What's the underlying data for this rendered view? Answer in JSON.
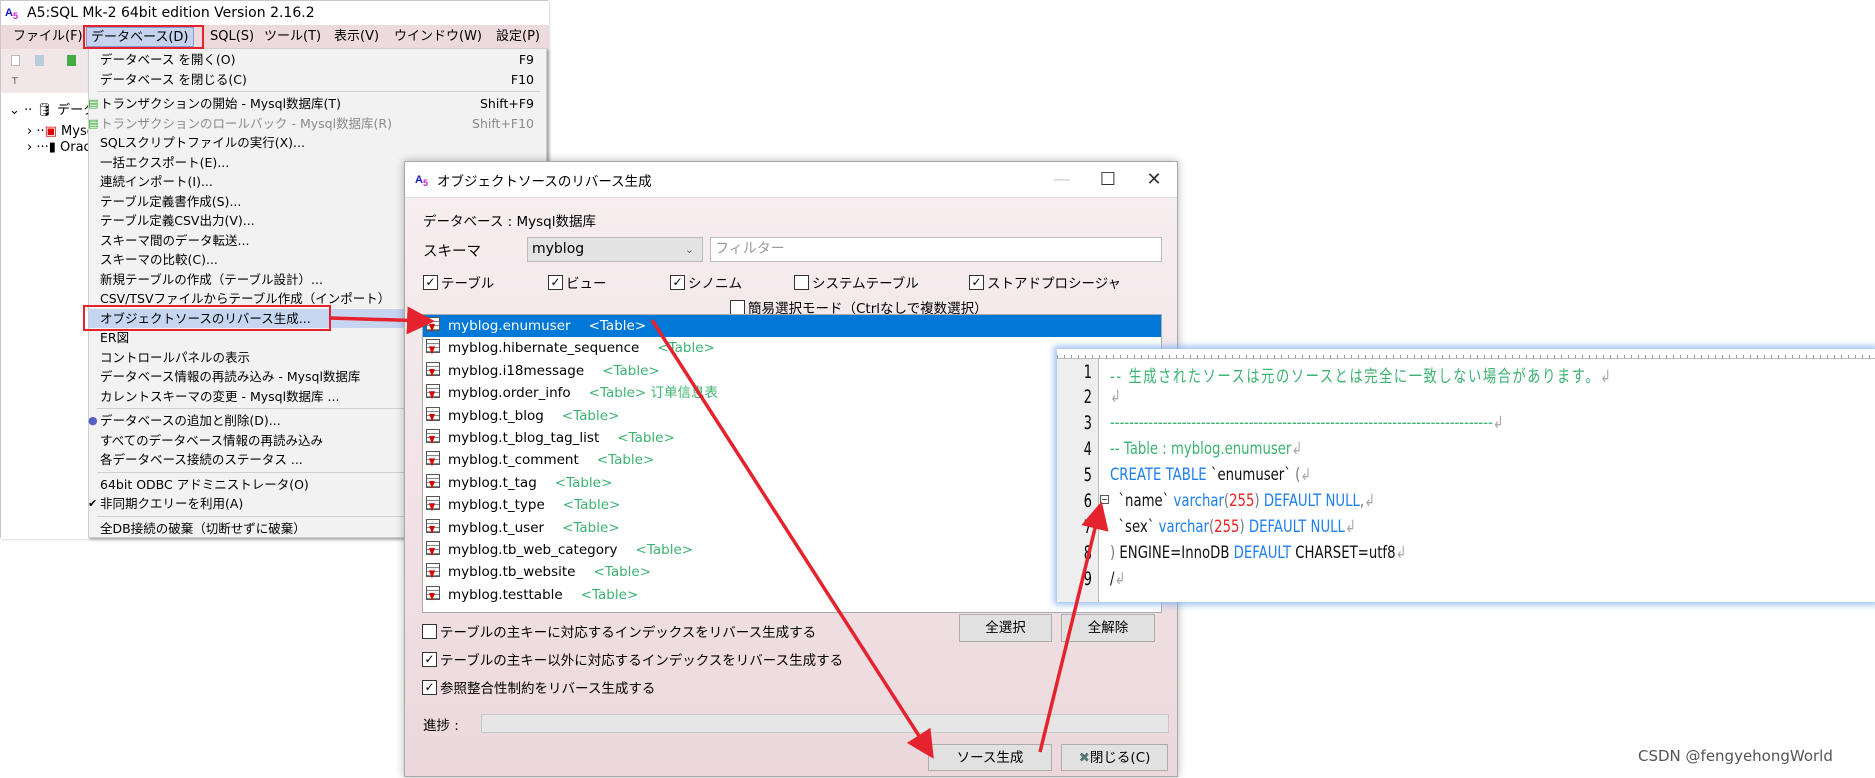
{
  "main_window": {
    "title": "A5:SQL Mk-2 64bit edition Version 2.16.2",
    "menubar": [
      "ファイル(F)",
      "データベース(D)",
      "SQL(S)",
      "ツール(T)",
      "表示(V)",
      "ウインドウ(W)",
      "設定(P)"
    ],
    "active_menu": "データベース(D)",
    "tree": {
      "root": "データベース",
      "items": [
        "Mysql数据库",
        "Oracle"
      ]
    }
  },
  "dropdown": {
    "items": [
      {
        "label": "データベース を開く(O)",
        "shortcut": "F9"
      },
      {
        "label": "データベース を閉じる(C)",
        "shortcut": "F10"
      },
      {
        "sep": true
      },
      {
        "label": "トランザクションの開始 - Mysql数据库(T)",
        "shortcut": "Shift+F9",
        "icon": "transaction-icon"
      },
      {
        "label": "トランザクションのロールバック - Mysql数据库(R)",
        "shortcut": "Shift+F10",
        "disabled": true,
        "icon": "rollback-icon"
      },
      {
        "label": "SQLスクリプトファイルの実行(X)..."
      },
      {
        "label": "一括エクスポート(E)..."
      },
      {
        "label": "連続インポート(I)..."
      },
      {
        "label": "テーブル定義書作成(S)..."
      },
      {
        "label": "テーブル定義CSV出力(V)..."
      },
      {
        "label": "スキーマ間のデータ転送..."
      },
      {
        "label": "スキーマの比較(C)..."
      },
      {
        "label": "新規テーブルの作成（テーブル設計）..."
      },
      {
        "label": "CSV/TSVファイルからテーブル作成（インポート）"
      },
      {
        "label": "オブジェクトソースのリバース生成...",
        "highlighted": true
      },
      {
        "label": "ER図"
      },
      {
        "label": "コントロールパネルの表示"
      },
      {
        "label": "データベース情報の再読み込み - Mysql数据库"
      },
      {
        "label": "カレントスキーマの変更 - Mysql数据库 ..."
      },
      {
        "sep": true
      },
      {
        "label": "データベースの追加と削除(D)...",
        "icon": "database-icon"
      },
      {
        "label": "すべてのデータベース情報の再読み込み"
      },
      {
        "label": "各データベース接続のステータス ..."
      },
      {
        "sep": true
      },
      {
        "label": "64bit ODBC アドミニストレータ(O)"
      },
      {
        "label": "非同期クエリーを利用(A)",
        "checked": true
      },
      {
        "sep": true
      },
      {
        "label": "全DB接続の破棄（切断せずに破棄）"
      }
    ]
  },
  "dialog": {
    "title": "オブジェクトソースのリバース生成",
    "database_label": "データベース : Mysql数据库",
    "schema_label": "スキーマ",
    "schema_value": "myblog",
    "filter_placeholder": "フィルター",
    "type_filters": [
      {
        "label": "テーブル",
        "checked": true
      },
      {
        "label": "ビュー",
        "checked": true
      },
      {
        "label": "シノニム",
        "checked": true
      },
      {
        "label": "システムテーブル",
        "checked": false
      },
      {
        "label": "ストアドプロシージャ",
        "checked": true
      }
    ],
    "simple_select": {
      "label": "簡易選択モード（Ctrlなしで複数選択）",
      "checked": false
    },
    "objects": [
      {
        "name": "myblog.enumuser",
        "type": "<Table>",
        "selected": true
      },
      {
        "name": "myblog.hibernate_sequence",
        "type": "<Table>"
      },
      {
        "name": "myblog.i18message",
        "type": "<Table>"
      },
      {
        "name": "myblog.order_info",
        "type": "<Table> 订单信息表"
      },
      {
        "name": "myblog.t_blog",
        "type": "<Table>"
      },
      {
        "name": "myblog.t_blog_tag_list",
        "type": "<Table>"
      },
      {
        "name": "myblog.t_comment",
        "type": "<Table>"
      },
      {
        "name": "myblog.t_tag",
        "type": "<Table>"
      },
      {
        "name": "myblog.t_type",
        "type": "<Table>"
      },
      {
        "name": "myblog.t_user",
        "type": "<Table>"
      },
      {
        "name": "myblog.tb_web_category",
        "type": "<Table>"
      },
      {
        "name": "myblog.tb_website",
        "type": "<Table>"
      },
      {
        "name": "myblog.testtable",
        "type": "<Table>"
      }
    ],
    "select_all": "全選択",
    "deselect_all": "全解除",
    "options": [
      {
        "label": "テーブルの主キーに対応するインデックスをリバース生成する",
        "checked": false
      },
      {
        "label": "テーブルの主キー以外に対応するインデックスをリバース生成する",
        "checked": true
      },
      {
        "label": "参照整合性制約をリバース生成する",
        "checked": true
      }
    ],
    "progress_label": "進捗 :",
    "progress_value": 0,
    "generate_button": "ソース生成",
    "close_button": "閉じる(C)"
  },
  "code_editor": {
    "lines": [
      {
        "n": "1",
        "tokens": [
          [
            "-- 生成されたソースは元のソースとは完全に一致しない場合があります。",
            "comment"
          ],
          [
            "↲",
            "mark"
          ]
        ]
      },
      {
        "n": "2",
        "tokens": [
          [
            "↲",
            "mark"
          ]
        ]
      },
      {
        "n": "3",
        "tokens": [
          [
            "--------------------------------------------------------------------------------",
            "comment"
          ],
          [
            "↲",
            "mark"
          ]
        ]
      },
      {
        "n": "4",
        "tokens": [
          [
            "-- Table : myblog.enumuser",
            "comment"
          ],
          [
            "↲",
            "mark"
          ]
        ]
      },
      {
        "n": "5",
        "tokens": [
          [
            "CREATE TABLE",
            "keyword"
          ],
          [
            " `enumuser` ",
            "plain"
          ],
          [
            "(",
            "paren"
          ],
          [
            "↲",
            "mark"
          ]
        ]
      },
      {
        "n": "6",
        "tokens": [
          [
            "  `name` ",
            "plain"
          ],
          [
            "varchar",
            "keyword"
          ],
          [
            "(",
            "paren"
          ],
          [
            "255",
            "number"
          ],
          [
            ") ",
            "paren"
          ],
          [
            "DEFAULT NULL",
            "keyword"
          ],
          [
            ",",
            "paren"
          ],
          [
            "↲",
            "mark"
          ]
        ]
      },
      {
        "n": "7",
        "tokens": [
          [
            "  `sex` ",
            "plain"
          ],
          [
            "varchar",
            "keyword"
          ],
          [
            "(",
            "paren"
          ],
          [
            "255",
            "number"
          ],
          [
            ") ",
            "paren"
          ],
          [
            "DEFAULT NULL",
            "keyword"
          ],
          [
            "↲",
            "mark"
          ]
        ]
      },
      {
        "n": "8",
        "tokens": [
          [
            ") ",
            "paren"
          ],
          [
            "ENGINE=InnoDB ",
            "plain"
          ],
          [
            "DEFAULT",
            "keyword"
          ],
          [
            " CHARSET=utf8",
            "plain"
          ],
          [
            "↲",
            "mark"
          ]
        ]
      },
      {
        "n": "9",
        "tokens": [
          [
            "/",
            "plain"
          ],
          [
            "↲",
            "mark"
          ]
        ]
      }
    ]
  },
  "watermark": "CSDN @fengyehongWorld",
  "colors": {
    "annotation_red": "#e5232e",
    "selection_blue": "#0078d7",
    "comment_green": "#3cb371",
    "keyword_blue": "#1e7ff0"
  }
}
